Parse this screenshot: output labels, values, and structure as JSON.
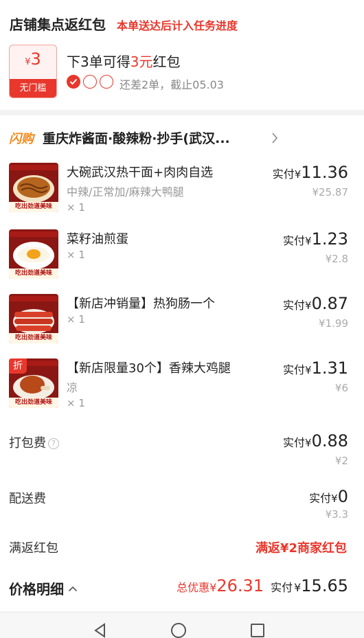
{
  "promo": {
    "title": "店铺集点返红包",
    "note": "本单送达后计入任务进度",
    "coupon_yen": "¥",
    "coupon_amount": "3",
    "coupon_tag": "无门槛",
    "progress_prefix": "下3单可得",
    "progress_highlight": "3元",
    "progress_suffix": "红包",
    "dots_total": 3,
    "dots_done": 1,
    "progress_sub": "还差2单，截止05.03"
  },
  "shop": {
    "flash_tag": "闪购",
    "name": "重庆炸酱面·酸辣粉·抄手(武汉..."
  },
  "items": [
    {
      "name": "大碗武汉热干面+肉肉自选",
      "spec": "中辣/正常加/麻辣大鸭腿",
      "qty": "× 1",
      "actual_label": "实付",
      "yen": "¥",
      "actual": "11.36",
      "original": "¥25.87",
      "banner": "吃出劲道美味",
      "discount_tag": ""
    },
    {
      "name": "菜籽油煎蛋",
      "spec": "",
      "qty": "× 1",
      "actual_label": "实付",
      "yen": "¥",
      "actual": "1.23",
      "original": "¥2.8",
      "banner": "吃出劲道美味",
      "discount_tag": ""
    },
    {
      "name": "【新店冲销量】热狗肠一个",
      "spec": "",
      "qty": "× 1",
      "actual_label": "实付",
      "yen": "¥",
      "actual": "0.87",
      "original": "¥1.99",
      "banner": "吃出劲道美味",
      "discount_tag": ""
    },
    {
      "name": "【新店限量30个】香辣大鸡腿",
      "spec": "凉",
      "qty": "× 1",
      "actual_label": "实付",
      "yen": "¥",
      "actual": "1.31",
      "original": "¥6",
      "banner": "吃出劲道美味",
      "discount_tag": "折"
    }
  ],
  "packing_fee": {
    "label": "打包费",
    "help_icon": "question-circle-icon",
    "help_glyph": "?",
    "actual_label": "实付",
    "yen": "¥",
    "actual": "0.88",
    "original": "¥2"
  },
  "delivery_fee": {
    "label": "配送费",
    "actual_label": "实付",
    "yen": "¥",
    "actual": "0",
    "original": "¥3.3"
  },
  "refund": {
    "label": "满返红包",
    "value": "满返¥2商家红包"
  },
  "summary": {
    "label": "价格明细",
    "discount_label": "总优惠",
    "yen": "¥",
    "discount": "26.31",
    "actual_label": "实付",
    "actual": "15.65"
  },
  "colors": {
    "accent_red": "#e8372c",
    "flash_orange": "#f28a1c",
    "muted_gray": "#999999"
  }
}
